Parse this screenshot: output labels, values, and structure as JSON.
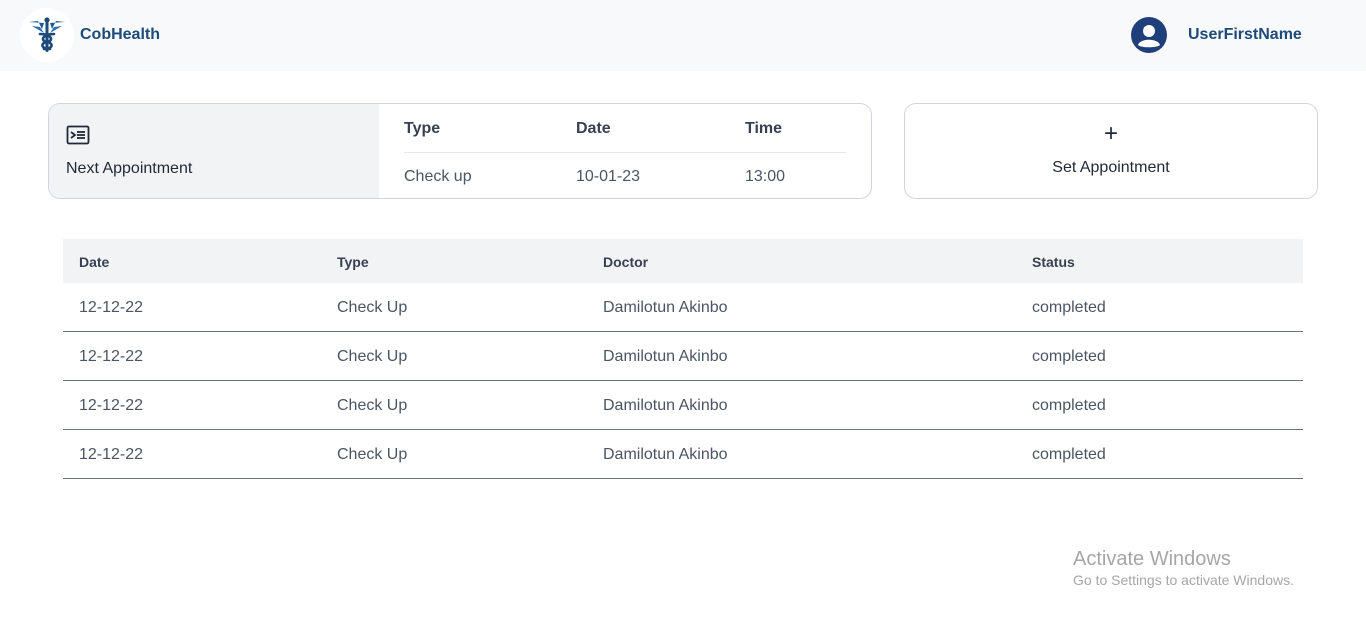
{
  "header": {
    "brand": "CobHealth",
    "username": "UserFirstName",
    "brand_color": "#1e4a7a"
  },
  "next_appointment": {
    "label": "Next Appointment",
    "icon": "ticket-list-icon",
    "columns": [
      "Type",
      "Date",
      "Time"
    ],
    "values": [
      "Check up",
      "10-01-23",
      "13:00"
    ]
  },
  "set_appointment": {
    "icon": "+",
    "label": "Set Appointment"
  },
  "appointments_table": {
    "headers": [
      "Date",
      "Type",
      "Doctor",
      "Status"
    ],
    "rows": [
      [
        "12-12-22",
        "Check Up",
        "Damilotun Akinbo",
        "completed"
      ],
      [
        "12-12-22",
        "Check Up",
        "Damilotun Akinbo",
        "completed"
      ],
      [
        "12-12-22",
        "Check Up",
        "Damilotun Akinbo",
        "completed"
      ],
      [
        "12-12-22",
        "Check Up",
        "Damilotun Akinbo",
        "completed"
      ]
    ]
  },
  "watermark": {
    "title": "Activate Windows",
    "subtitle": "Go to Settings to activate Windows."
  }
}
